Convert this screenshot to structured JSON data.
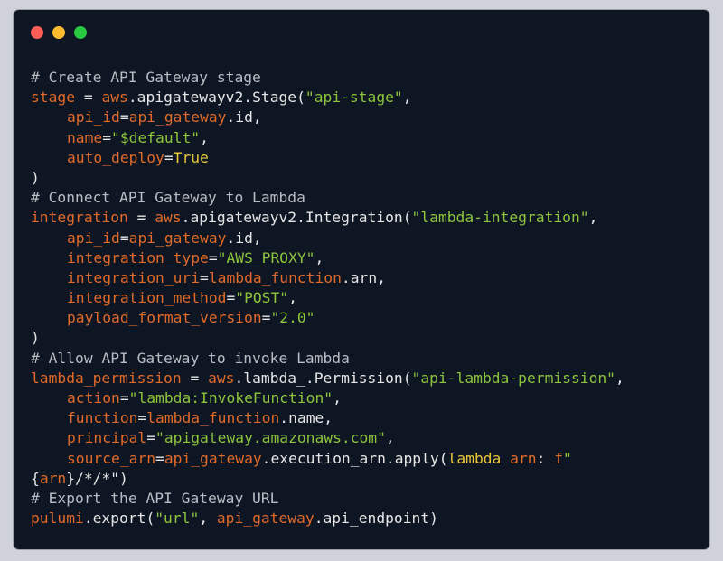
{
  "window": {
    "controls": [
      {
        "name": "close",
        "color": "#ff5f57"
      },
      {
        "name": "minimize",
        "color": "#febc2e"
      },
      {
        "name": "zoom",
        "color": "#28c840"
      }
    ]
  },
  "colors": {
    "background": "#0f1623",
    "comment": "#b9bcc3",
    "identifier": "#e06a2a",
    "plain": "#e6e6e6",
    "string": "#8cc43d",
    "keyword": "#e8c63c"
  },
  "code": {
    "lines": [
      {
        "indent": 0,
        "tokens": [
          {
            "t": "comment",
            "v": "# Create API Gateway stage"
          }
        ]
      },
      {
        "indent": 0,
        "tokens": [
          {
            "t": "var",
            "v": "stage"
          },
          {
            "t": "plain",
            "v": " = "
          },
          {
            "t": "var",
            "v": "aws"
          },
          {
            "t": "plain",
            "v": ".apigatewayv2.Stage("
          },
          {
            "t": "str",
            "v": "\"api-stage\""
          },
          {
            "t": "plain",
            "v": ","
          }
        ]
      },
      {
        "indent": 1,
        "tokens": [
          {
            "t": "var",
            "v": "api_id"
          },
          {
            "t": "plain",
            "v": "="
          },
          {
            "t": "var",
            "v": "api_gateway"
          },
          {
            "t": "plain",
            "v": ".id,"
          }
        ]
      },
      {
        "indent": 1,
        "tokens": [
          {
            "t": "var",
            "v": "name"
          },
          {
            "t": "plain",
            "v": "="
          },
          {
            "t": "str",
            "v": "\"$default\""
          },
          {
            "t": "plain",
            "v": ","
          }
        ]
      },
      {
        "indent": 1,
        "tokens": [
          {
            "t": "var",
            "v": "auto_deploy"
          },
          {
            "t": "plain",
            "v": "="
          },
          {
            "t": "kw",
            "v": "True"
          }
        ]
      },
      {
        "indent": 0,
        "tokens": [
          {
            "t": "plain",
            "v": ")"
          }
        ]
      },
      {
        "indent": 0,
        "tokens": [
          {
            "t": "comment",
            "v": "# Connect API Gateway to Lambda"
          }
        ]
      },
      {
        "indent": 0,
        "tokens": [
          {
            "t": "var",
            "v": "integration"
          },
          {
            "t": "plain",
            "v": " = "
          },
          {
            "t": "var",
            "v": "aws"
          },
          {
            "t": "plain",
            "v": ".apigatewayv2.Integration("
          },
          {
            "t": "str",
            "v": "\"lambda-integration\""
          },
          {
            "t": "plain",
            "v": ","
          }
        ]
      },
      {
        "indent": 1,
        "tokens": [
          {
            "t": "var",
            "v": "api_id"
          },
          {
            "t": "plain",
            "v": "="
          },
          {
            "t": "var",
            "v": "api_gateway"
          },
          {
            "t": "plain",
            "v": ".id,"
          }
        ]
      },
      {
        "indent": 1,
        "tokens": [
          {
            "t": "var",
            "v": "integration_type"
          },
          {
            "t": "plain",
            "v": "="
          },
          {
            "t": "str",
            "v": "\"AWS_PROXY\""
          },
          {
            "t": "plain",
            "v": ","
          }
        ]
      },
      {
        "indent": 1,
        "tokens": [
          {
            "t": "var",
            "v": "integration_uri"
          },
          {
            "t": "plain",
            "v": "="
          },
          {
            "t": "var",
            "v": "lambda_function"
          },
          {
            "t": "plain",
            "v": ".arn,"
          }
        ]
      },
      {
        "indent": 1,
        "tokens": [
          {
            "t": "var",
            "v": "integration_method"
          },
          {
            "t": "plain",
            "v": "="
          },
          {
            "t": "str",
            "v": "\"POST\""
          },
          {
            "t": "plain",
            "v": ","
          }
        ]
      },
      {
        "indent": 1,
        "tokens": [
          {
            "t": "var",
            "v": "payload_format_version"
          },
          {
            "t": "plain",
            "v": "="
          },
          {
            "t": "str",
            "v": "\"2.0\""
          }
        ]
      },
      {
        "indent": 0,
        "tokens": [
          {
            "t": "plain",
            "v": ")"
          }
        ]
      },
      {
        "indent": 0,
        "tokens": [
          {
            "t": "comment",
            "v": "# Allow API Gateway to invoke Lambda"
          }
        ]
      },
      {
        "indent": 0,
        "tokens": [
          {
            "t": "var",
            "v": "lambda_permission"
          },
          {
            "t": "plain",
            "v": " = "
          },
          {
            "t": "var",
            "v": "aws"
          },
          {
            "t": "plain",
            "v": ".lambda_.Permission("
          },
          {
            "t": "str",
            "v": "\"api-lambda-permission\""
          },
          {
            "t": "plain",
            "v": ","
          }
        ]
      },
      {
        "indent": 1,
        "tokens": [
          {
            "t": "var",
            "v": "action"
          },
          {
            "t": "plain",
            "v": "="
          },
          {
            "t": "str",
            "v": "\"lambda:InvokeFunction\""
          },
          {
            "t": "plain",
            "v": ","
          }
        ]
      },
      {
        "indent": 1,
        "tokens": [
          {
            "t": "var",
            "v": "function"
          },
          {
            "t": "plain",
            "v": "="
          },
          {
            "t": "var",
            "v": "lambda_function"
          },
          {
            "t": "plain",
            "v": ".name,"
          }
        ]
      },
      {
        "indent": 1,
        "tokens": [
          {
            "t": "var",
            "v": "principal"
          },
          {
            "t": "plain",
            "v": "="
          },
          {
            "t": "str",
            "v": "\"apigateway.amazonaws.com\""
          },
          {
            "t": "plain",
            "v": ","
          }
        ]
      },
      {
        "indent": 1,
        "tokens": [
          {
            "t": "var",
            "v": "source_arn"
          },
          {
            "t": "plain",
            "v": "="
          },
          {
            "t": "var",
            "v": "api_gateway"
          },
          {
            "t": "plain",
            "v": ".execution_arn.apply("
          },
          {
            "t": "kw",
            "v": "lambda"
          },
          {
            "t": "plain",
            "v": " "
          },
          {
            "t": "var",
            "v": "arn"
          },
          {
            "t": "plain",
            "v": ": "
          },
          {
            "t": "var",
            "v": "f"
          },
          {
            "t": "str",
            "v": "\""
          }
        ]
      },
      {
        "indent": 0,
        "tokens": [
          {
            "t": "plain",
            "v": "{"
          },
          {
            "t": "var",
            "v": "arn"
          },
          {
            "t": "plain",
            "v": "}/*/*\")"
          }
        ]
      },
      {
        "indent": 0,
        "tokens": [
          {
            "t": "comment",
            "v": "# Export the API Gateway URL"
          }
        ]
      },
      {
        "indent": 0,
        "tokens": [
          {
            "t": "var",
            "v": "pulumi"
          },
          {
            "t": "plain",
            "v": ".export("
          },
          {
            "t": "str",
            "v": "\"url\""
          },
          {
            "t": "plain",
            "v": ", "
          },
          {
            "t": "var",
            "v": "api_gateway"
          },
          {
            "t": "plain",
            "v": ".api_endpoint)"
          }
        ]
      }
    ]
  }
}
